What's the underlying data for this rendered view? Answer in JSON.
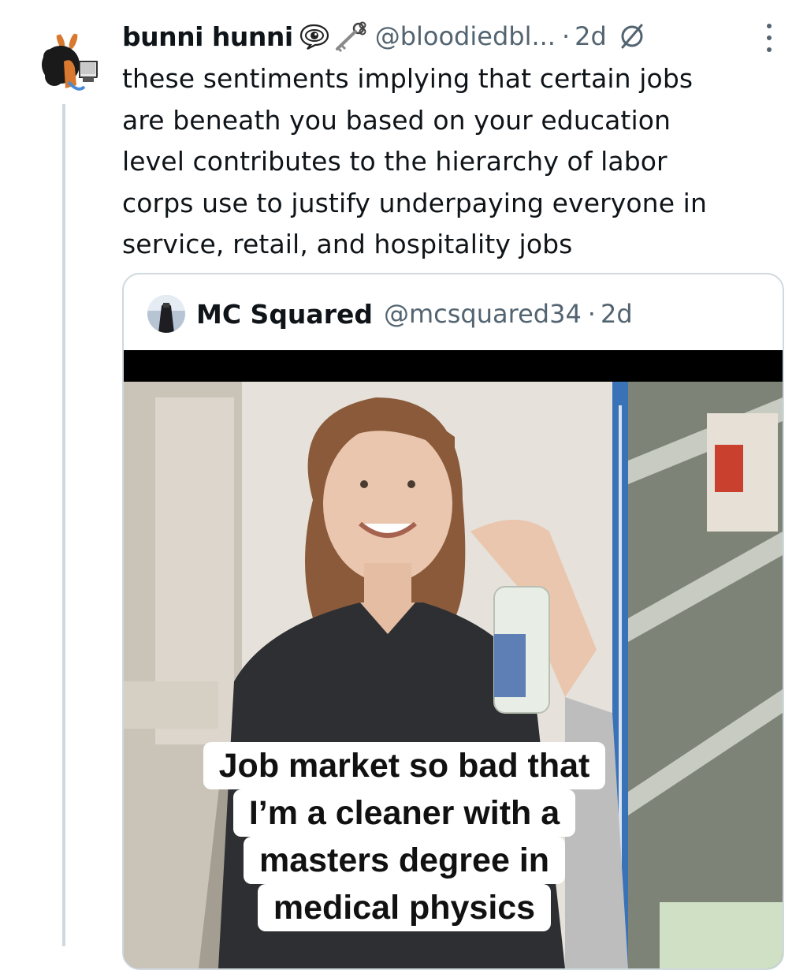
{
  "tweet": {
    "display_name": "bunni hunni",
    "handle": "@bloodiedbl...",
    "separator": "·",
    "time": "2d",
    "text_lines": [
      "these sentiments implying that certain jobs",
      "are beneath you based on your education",
      "level contributes to the hierarchy of labor",
      "corps use to justify underpaying everyone in",
      "service, retail, and hospitality jobs"
    ]
  },
  "icons": {
    "name_emoji": [
      "eye-in-speech-bubble-icon",
      "key-icon"
    ],
    "edited": "edited-indicator-icon",
    "more": "more-options-icon"
  },
  "quote": {
    "display_name": "MC Squared",
    "handle": "@mcsquared34",
    "separator": "·",
    "time": "2d",
    "caption_lines": [
      "Job market so bad that",
      "I’m a cleaner with a",
      "masters degree in",
      "medical physics"
    ]
  },
  "colors": {
    "primary_text": "#0f1419",
    "secondary_text": "#536471",
    "border": "#cfd9de",
    "shelf_blue": "#3a72b8"
  }
}
